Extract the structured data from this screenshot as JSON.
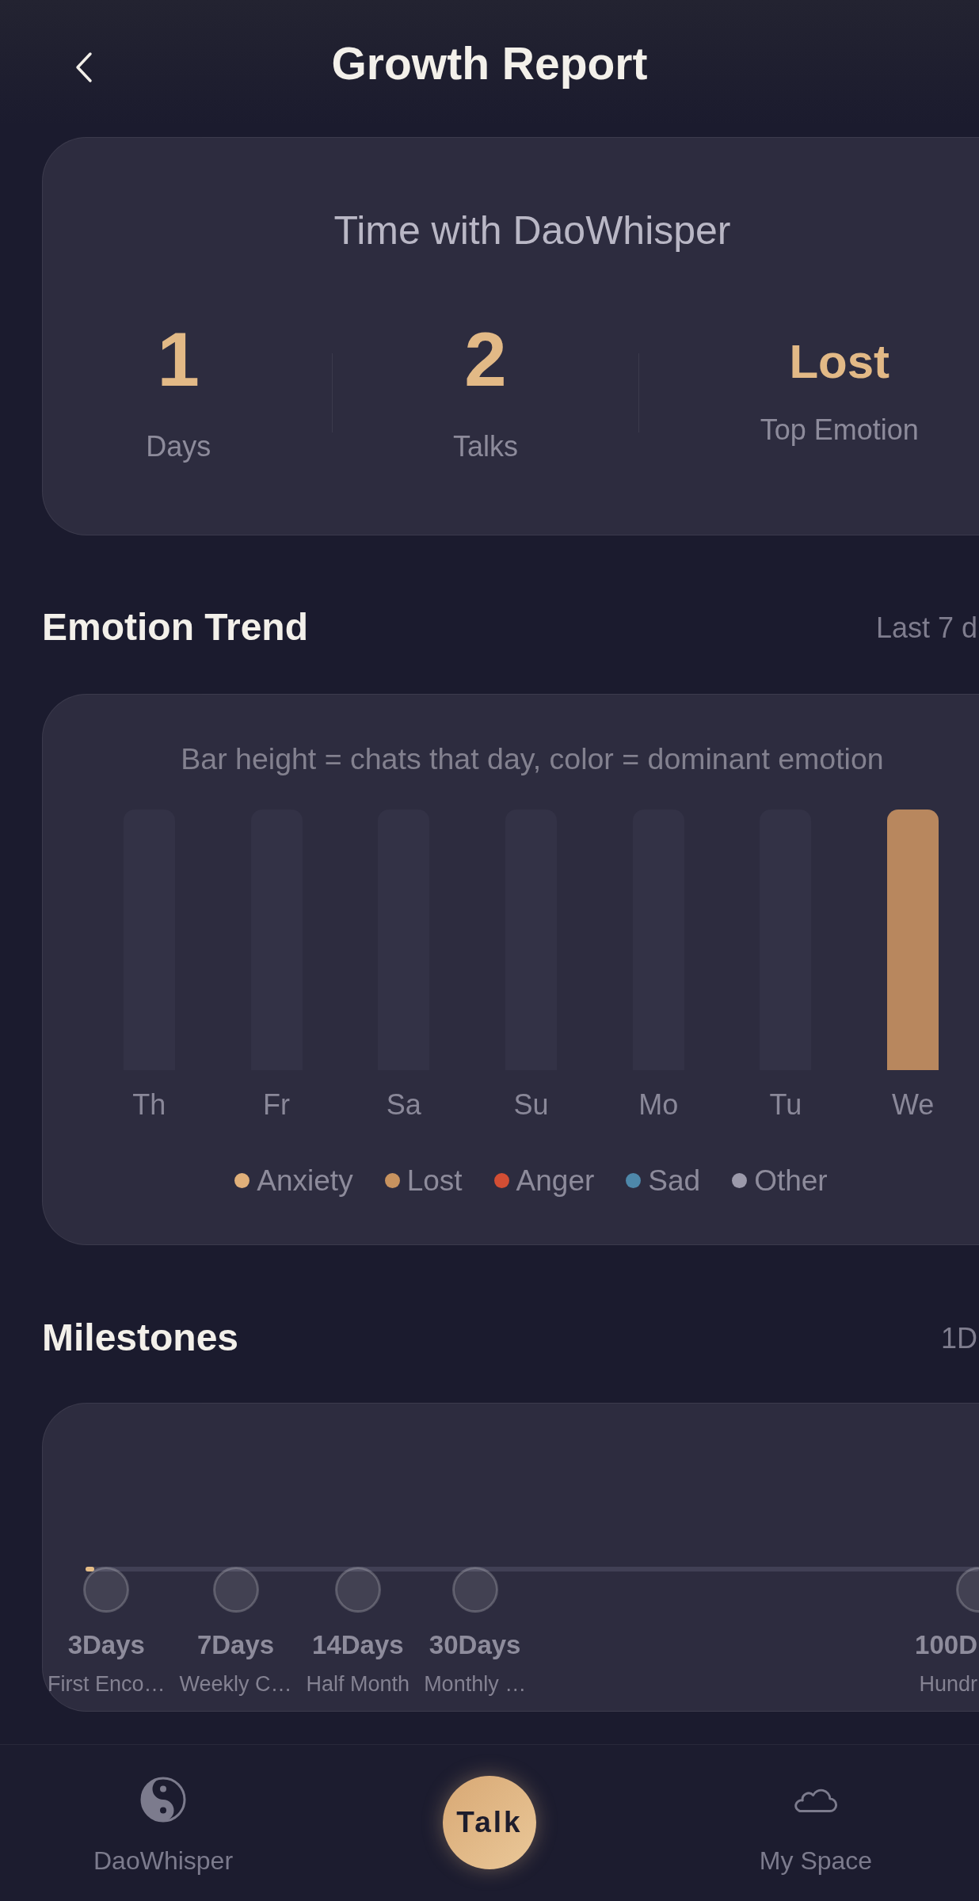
{
  "header": {
    "title": "Growth Report"
  },
  "summary": {
    "title": "Time with DaoWhisper",
    "stats": [
      {
        "kind": "number",
        "value": "1",
        "label": "Days"
      },
      {
        "kind": "number",
        "value": "2",
        "label": "Talks"
      },
      {
        "kind": "word",
        "value": "Lost",
        "label": "Top Emotion"
      }
    ]
  },
  "trend": {
    "title": "Emotion Trend",
    "meta": "Last 7 d",
    "caption": "Bar height = chats that day, color = dominant emotion",
    "days": [
      {
        "label": "Th"
      },
      {
        "label": "Fr"
      },
      {
        "label": "Sa"
      },
      {
        "label": "Su"
      },
      {
        "label": "Mo"
      },
      {
        "label": "Tu"
      },
      {
        "label": "We",
        "color": "#b8875e"
      }
    ],
    "legend": [
      {
        "label": "Anxiety",
        "color": "#e0b07a"
      },
      {
        "label": "Lost",
        "color": "#c8935f"
      },
      {
        "label": "Anger",
        "color": "#d24e34"
      },
      {
        "label": "Sad",
        "color": "#4e88aa"
      },
      {
        "label": "Other",
        "color": "#9c9aab"
      }
    ]
  },
  "milestones": {
    "title": "Milestones",
    "meta": "1D",
    "level": 0.01,
    "items": [
      {
        "title": "3Days",
        "subtitle": "First Enco…",
        "reached": false
      },
      {
        "title": "7Days",
        "subtitle": "Weekly C…",
        "reached": false
      },
      {
        "title": "14Days",
        "subtitle": "Half Month",
        "reached": false
      },
      {
        "title": "30Days",
        "subtitle": "Monthly …",
        "reached": false
      },
      {
        "title": "100D",
        "subtitle": "Hundr",
        "reached": false
      }
    ]
  },
  "nav": [
    {
      "kind": "tab",
      "label": "DaoWhisper",
      "selected": false
    },
    {
      "kind": "action",
      "label": "Talk"
    },
    {
      "kind": "tab",
      "label": "My Space",
      "selected": false
    }
  ]
}
